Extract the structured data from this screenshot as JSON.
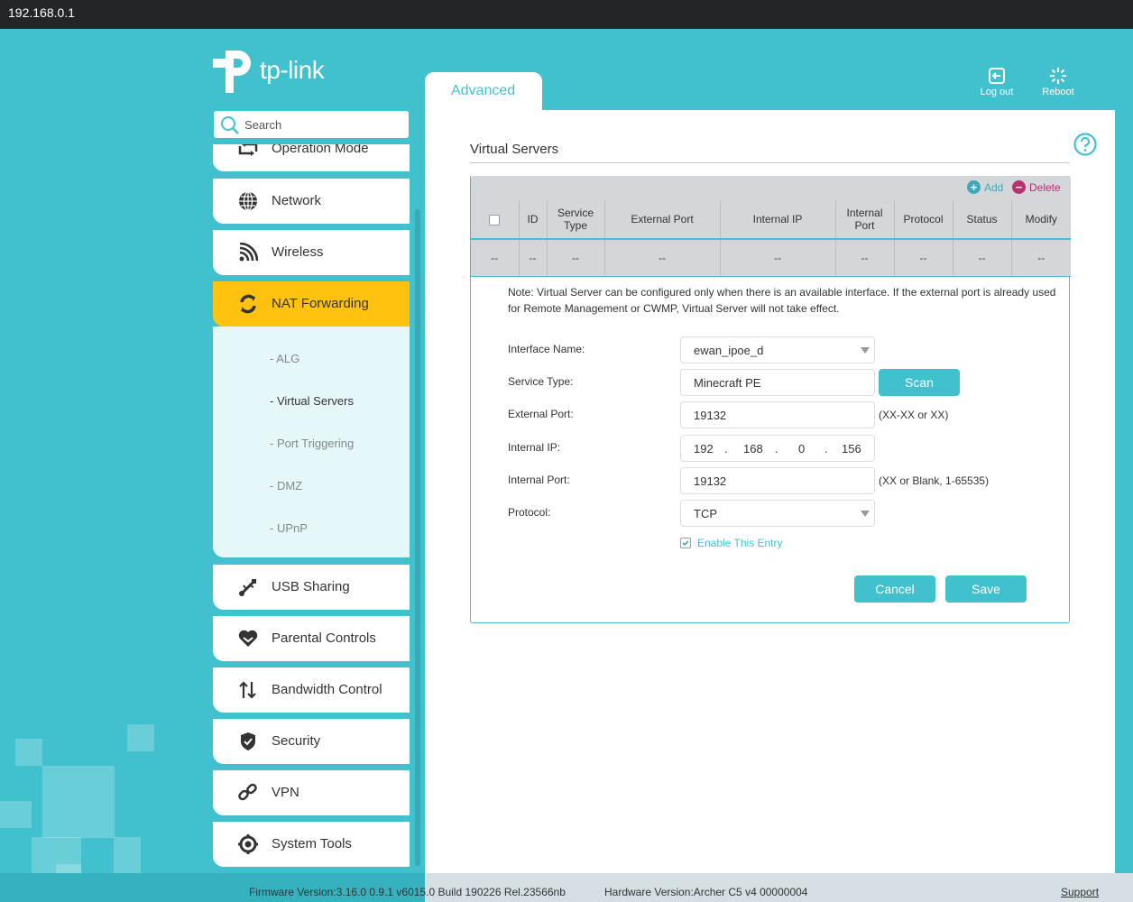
{
  "browser": {
    "url": "192.168.0.1"
  },
  "logo": {
    "brand": "tp-link"
  },
  "search": {
    "placeholder": "Search"
  },
  "header": {
    "tab_label": "Advanced",
    "logout_label": "Log out",
    "reboot_label": "Reboot"
  },
  "sidebar": {
    "items": [
      {
        "label": "Operation Mode",
        "icon": "operation-mode-icon"
      },
      {
        "label": "Network",
        "icon": "globe-icon"
      },
      {
        "label": "Wireless",
        "icon": "wifi-icon"
      },
      {
        "label": "NAT Forwarding",
        "icon": "nat-icon",
        "active": true
      },
      {
        "label": "USB Sharing",
        "icon": "usb-icon"
      },
      {
        "label": "Parental Controls",
        "icon": "heart-icon"
      },
      {
        "label": "Bandwidth Control",
        "icon": "up-down-arrows-icon"
      },
      {
        "label": "Security",
        "icon": "shield-icon"
      },
      {
        "label": "VPN",
        "icon": "link-icon"
      },
      {
        "label": "System Tools",
        "icon": "gear-icon"
      }
    ],
    "subitems": [
      {
        "label": "- ALG"
      },
      {
        "label": "- Virtual Servers",
        "active": true
      },
      {
        "label": "- Port Triggering"
      },
      {
        "label": "- DMZ"
      },
      {
        "label": "- UPnP"
      }
    ]
  },
  "main": {
    "title": "Virtual Servers",
    "actions": {
      "add": "Add",
      "delete": "Delete"
    },
    "table": {
      "columns": [
        "",
        "ID",
        "Service\nType",
        "External Port",
        "Internal IP",
        "Internal\nPort",
        "Protocol",
        "Status",
        "Modify"
      ],
      "rows": [
        [
          "--",
          "--",
          "--",
          "--",
          "--",
          "--",
          "--",
          "--",
          "--"
        ]
      ]
    },
    "note": "Note: Virtual Server can be configured only when there is an available interface. If the external port is already used for Remote Management or CWMP, Virtual Server will not take effect.",
    "form": {
      "interface_label": "Interface Name:",
      "interface_value": "ewan_ipoe_d",
      "service_label": "Service Type:",
      "service_value": "Minecraft PE",
      "scan_label": "Scan",
      "ext_port_label": "External Port:",
      "ext_port_value": "19132",
      "ext_port_hint": "(XX-XX or XX)",
      "int_ip_label": "Internal IP:",
      "int_ip": [
        "192",
        "168",
        "0",
        "156"
      ],
      "int_port_label": "Internal Port:",
      "int_port_value": "19132",
      "int_port_hint": "(XX or Blank, 1-65535)",
      "protocol_label": "Protocol:",
      "protocol_value": "TCP",
      "enable_label": "Enable This Entry",
      "enable_checked": true,
      "cancel_label": "Cancel",
      "save_label": "Save"
    }
  },
  "footer": {
    "firmware": "Firmware Version:3.16.0 0.9.1 v6015.0 Build 190226 Rel.23566nb",
    "hardware": "Hardware Version:Archer C5 v4 00000004",
    "support": "Support"
  },
  "colors": {
    "accent": "#41c1cd",
    "active_nav": "#ffc20e",
    "delete": "#b5336d"
  }
}
